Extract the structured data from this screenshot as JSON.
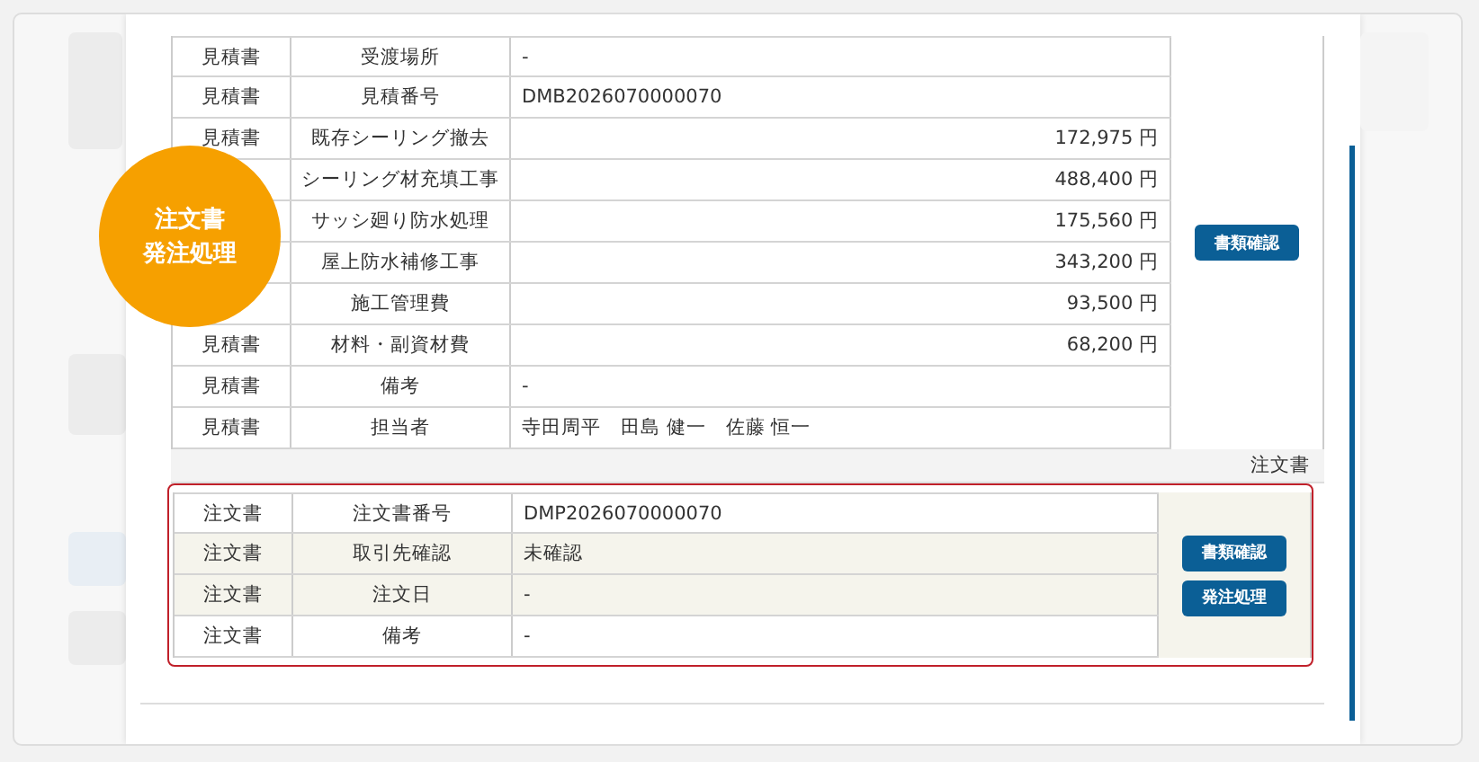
{
  "badge": {
    "lines": [
      "注文書",
      "発注処理"
    ]
  },
  "quote_table": {
    "rows": [
      {
        "document": "見積書",
        "item": "受渡場所",
        "value": "-",
        "kind": "text"
      },
      {
        "document": "見積書",
        "item": "見積番号",
        "value": "DMB2026070000070",
        "kind": "text"
      },
      {
        "document": "見積書",
        "item": "既存シーリング撤去",
        "value": "172,975 円",
        "kind": "amount"
      },
      {
        "item": "シーリング材充填工事",
        "value": "488,400 円",
        "kind": "amount"
      },
      {
        "item": "サッシ廻り防水処理",
        "value": "175,560 円",
        "kind": "amount"
      },
      {
        "item": "屋上防水補修工事",
        "value": "343,200 円",
        "kind": "amount"
      },
      {
        "item": "施工管理費",
        "value": "93,500 円",
        "kind": "amount"
      },
      {
        "document": "見積書",
        "item": "材料・副資材費",
        "value": "68,200 円",
        "kind": "amount"
      },
      {
        "document": "見積書",
        "item": "備考",
        "value": "-",
        "kind": "text"
      },
      {
        "document": "見積書",
        "item": "担当者",
        "value": "寺田周平　田島 健一　佐藤 恒一",
        "kind": "text"
      }
    ],
    "buttons": [
      "書類確認"
    ]
  },
  "order_section": {
    "label": "注文書",
    "highlighted": true,
    "rows": [
      {
        "document": "注文書",
        "item": "注文書番号",
        "value": "DMP2026070000070",
        "shaded": false
      },
      {
        "document": "注文書",
        "item": "取引先確認",
        "value": "未確認",
        "shaded": true
      },
      {
        "document": "注文書",
        "item": "注文日",
        "value": "-",
        "shaded": true
      },
      {
        "document": "注文書",
        "item": "備考",
        "value": "-",
        "shaded": false
      }
    ],
    "buttons": [
      "書類確認",
      "発注処理"
    ]
  }
}
